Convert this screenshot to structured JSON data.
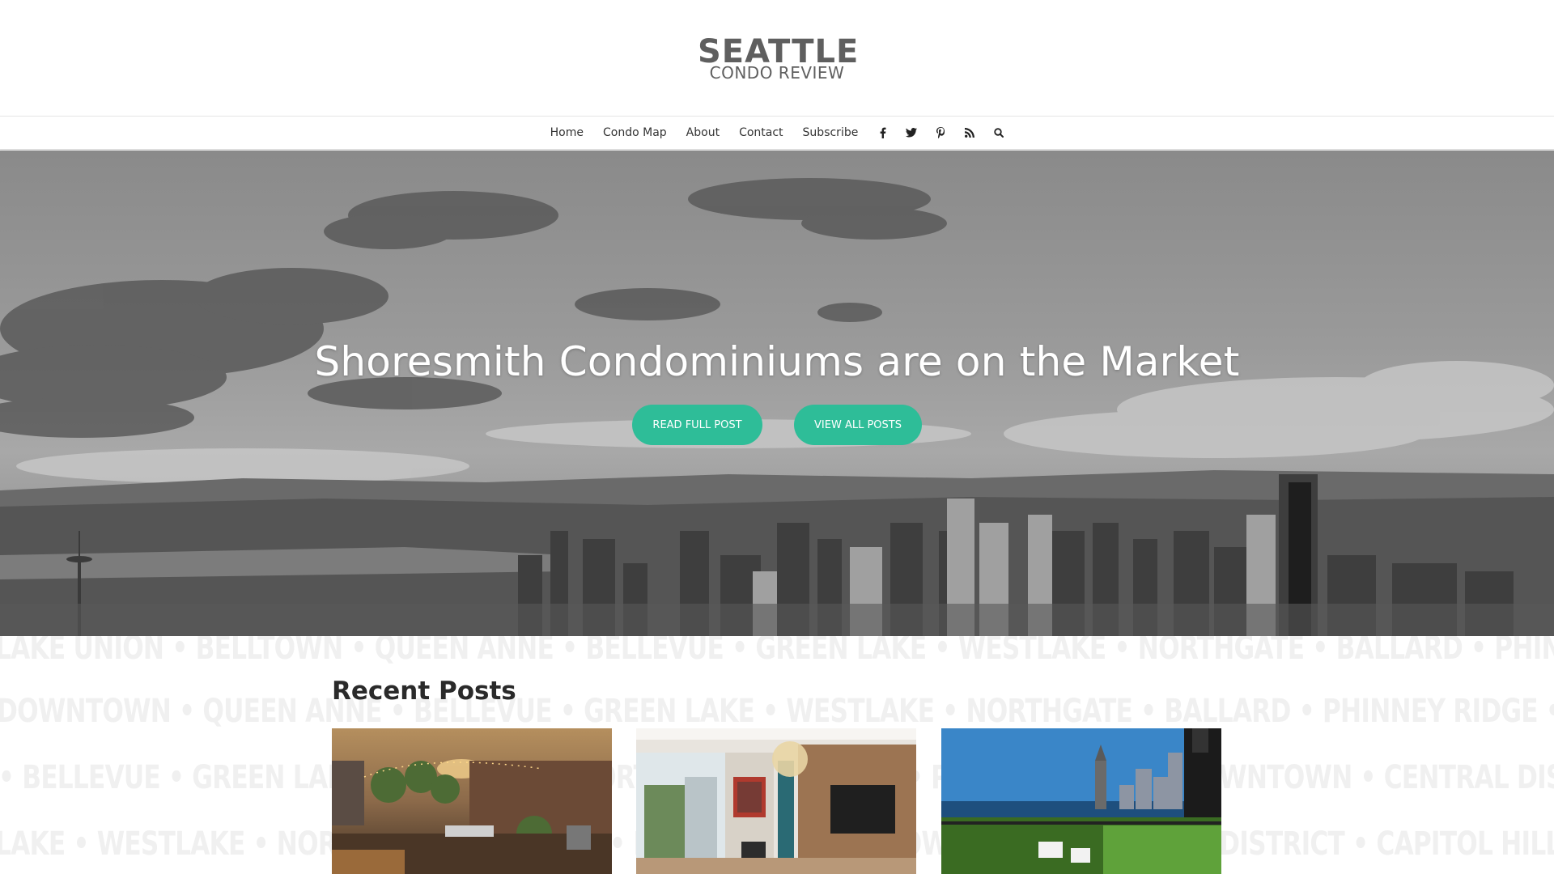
{
  "site": {
    "logo_main": "SEATTLE",
    "logo_sub": "CONDO REVIEW"
  },
  "nav": {
    "items": [
      {
        "label": "Home"
      },
      {
        "label": "Condo Map"
      },
      {
        "label": "About"
      },
      {
        "label": "Contact"
      },
      {
        "label": "Subscribe"
      }
    ],
    "icons": [
      "facebook-icon",
      "twitter-icon",
      "pinterest-icon",
      "rss-icon",
      "search-icon"
    ]
  },
  "hero": {
    "title": "Shoresmith Condominiums are on the Market",
    "read_button": "READ FULL POST",
    "view_button": "VIEW ALL POSTS",
    "button_color": "#2ebd98"
  },
  "watermark": {
    "rows": [
      "LAKE UNION • BELLTOWN • QUEEN ANNE • BELLEVUE • GREEN LAKE • WESTLAKE • NORTHGATE • BALLARD • PHINNEY RIDGE",
      "DOWNTOWN • QUEEN ANNE • BELLEVUE • GREEN LAKE • WESTLAKE • NORTHGATE • BALLARD • PHINNEY RIDGE • DOWNTOWN",
      "• BELLEVUE • GREEN LAKE • WESTLAKE • NORTHGATE • BALLARD • PHINNEY RIDGE • DOWNTOWN • CENTRAL DISTRICT",
      "LAKE • WESTLAKE • NORTHGATE • BALLARD • PHINNEY RIDGE • DOWNTOWN • CENTRAL DISTRICT • CAPITOL HILL"
    ]
  },
  "recent": {
    "title": "Recent Posts"
  }
}
